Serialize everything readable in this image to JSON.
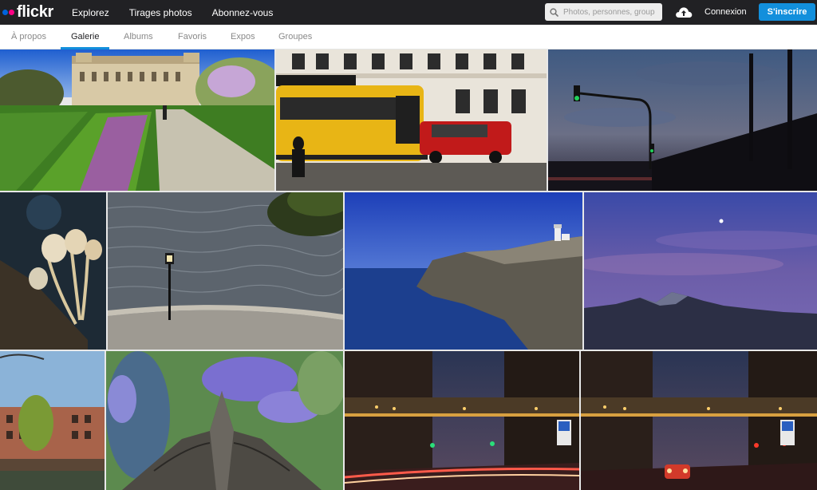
{
  "header": {
    "logo_text": "flickr",
    "logo_dot_colors": [
      "#0063dc",
      "#ff0084"
    ],
    "nav": [
      "Explorez",
      "Tirages photos",
      "Abonnez-vous"
    ],
    "search_placeholder": "Photos, personnes, groupes",
    "login_label": "Connexion",
    "signup_label": "S'inscrire",
    "accent_color": "#128fdc"
  },
  "subnav": {
    "items": [
      "À propos",
      "Galerie",
      "Albums",
      "Favoris",
      "Expos",
      "Groupes"
    ],
    "active": "Galerie"
  },
  "gallery": {
    "rows": [
      [
        "paris-garden",
        "yellow-tram",
        "dusk-railway"
      ],
      [
        "mushrooms",
        "river-lamp",
        "coast-lighthouse",
        "mountain-moon"
      ],
      [
        "canal-houses",
        "moth-flowers",
        "night-street-1",
        "night-street-2"
      ]
    ]
  }
}
